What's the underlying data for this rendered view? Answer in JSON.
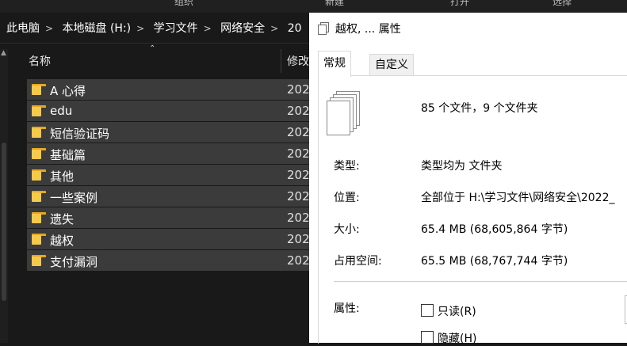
{
  "ribbon": {
    "items": [
      "组织",
      "新建",
      "打开",
      "选择"
    ]
  },
  "breadcrumb": {
    "items": [
      "此电脑",
      "本地磁盘 (H:)",
      "学习文件",
      "网络安全",
      "20"
    ],
    "separator": ">"
  },
  "list": {
    "col_name": "名称",
    "col_modified": "修改",
    "rows": [
      {
        "name": "A 心得",
        "date": "202"
      },
      {
        "name": "edu",
        "date": "202"
      },
      {
        "name": "短信验证码",
        "date": "202"
      },
      {
        "name": "基础篇",
        "date": "202"
      },
      {
        "name": "其他",
        "date": "202"
      },
      {
        "name": "一些案例",
        "date": "202"
      },
      {
        "name": "遗失",
        "date": "202"
      },
      {
        "name": "越权",
        "date": "202"
      },
      {
        "name": "支付漏洞",
        "date": "202"
      }
    ]
  },
  "dialog": {
    "title": "越权, ... 属性",
    "tabs": [
      "常规",
      "自定义"
    ],
    "summary": "85 个文件，9 个文件夹",
    "type_label": "类型:",
    "type_value": "类型均为 文件夹",
    "location_label": "位置:",
    "location_value": "全部位于 H:\\学习文件\\网络安全\\2022_",
    "size_label": "大小:",
    "size_value": "65.4 MB (68,605,864 字节)",
    "disk_label": "占用空间:",
    "disk_value": "65.5 MB (68,767,744 字节)",
    "attr_label": "属性:",
    "readonly_label": "只读(R)",
    "hidden_label": "隐藏(H)"
  },
  "colors": {
    "folder": "#f7c948",
    "selected_row": "#3b3b3b",
    "dark_bg": "#191919"
  }
}
